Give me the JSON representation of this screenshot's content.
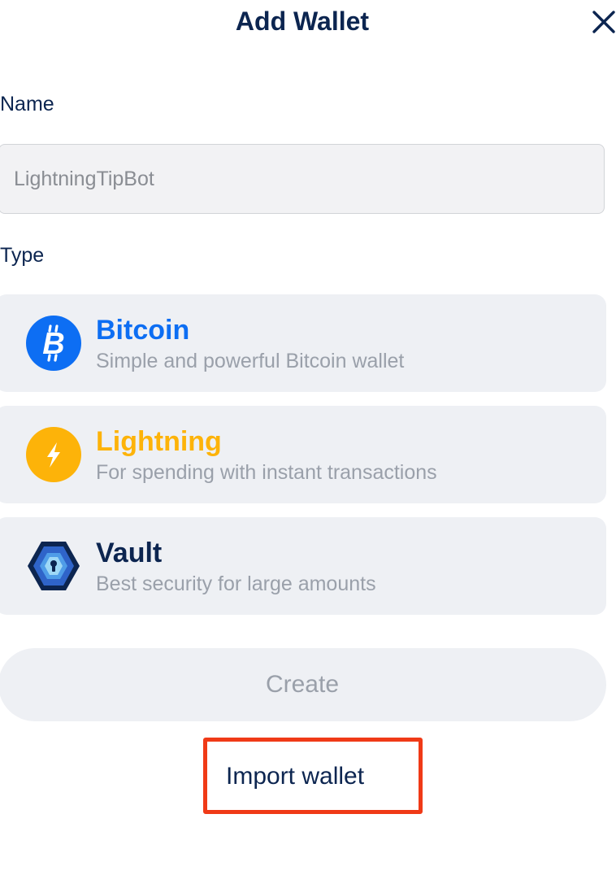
{
  "header": {
    "title": "Add Wallet",
    "close_icon": "close-icon"
  },
  "name_section": {
    "label": "Name",
    "input_placeholder": "LightningTipBot",
    "input_value": ""
  },
  "type_section": {
    "label": "Type",
    "options": [
      {
        "title": "Bitcoin",
        "description": "Simple and powerful Bitcoin wallet",
        "icon": "bitcoin-icon",
        "color": "#0d6ef3"
      },
      {
        "title": "Lightning",
        "description": "For spending with instant transactions",
        "icon": "lightning-icon",
        "color": "#fdb309"
      },
      {
        "title": "Vault",
        "description": "Best security for large amounts",
        "icon": "vault-icon",
        "color": "#0c2550"
      }
    ]
  },
  "actions": {
    "create_label": "Create",
    "import_label": "Import wallet"
  },
  "colors": {
    "text_primary": "#0c2550",
    "text_secondary": "#9aa0aa",
    "card_background": "#eef0f4",
    "highlight": "#f03a17"
  }
}
